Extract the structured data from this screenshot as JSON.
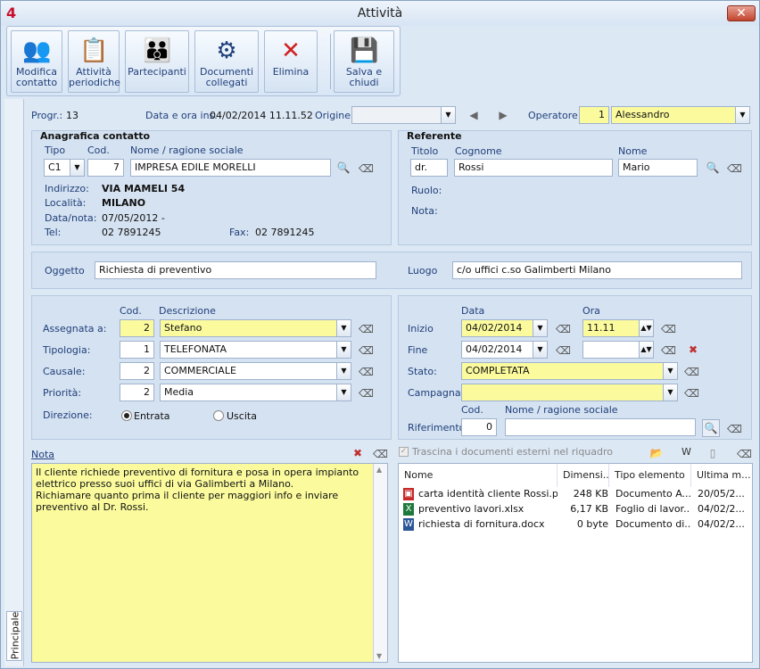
{
  "window": {
    "app_number": "4",
    "title": "Attività",
    "close": "✕"
  },
  "toolbar": {
    "modifica": "Modifica contatto",
    "attivita": "Attività periodiche",
    "partecipanti": "Partecipanti",
    "documenti": "Documenti collegati",
    "elimina": "Elimina",
    "salva": "Salva e chiudi"
  },
  "tab": {
    "principale": "Principale"
  },
  "header": {
    "progr_label": "Progr.:",
    "progr_value": "13",
    "data_label": "Data e ora ins.",
    "data_value": "04/02/2014 11.11.52",
    "origine_label": "Origine:",
    "origine_value": "",
    "operatore_label": "Operatore",
    "operatore_code": "1",
    "operatore_name": "Alessandro"
  },
  "anagrafica": {
    "title": "Anagrafica contatto",
    "tipo_label": "Tipo",
    "cod_label": "Cod.",
    "nome_label": "Nome / ragione sociale",
    "tipo": "C1",
    "cod": "7",
    "nome": "IMPRESA EDILE MORELLI",
    "indirizzo_label": "Indirizzo:",
    "indirizzo": "VIA MAMELI 54",
    "localita_label": "Località:",
    "localita": "MILANO",
    "datanota_label": "Data/nota:",
    "datanota": "07/05/2012 -",
    "tel_label": "Tel:",
    "tel": "02 7891245",
    "fax_label": "Fax:",
    "fax": "02 7891245"
  },
  "referente": {
    "title": "Referente",
    "titolo_label": "Titolo",
    "cognome_label": "Cognome",
    "nome_label": "Nome",
    "titolo": "dr.",
    "cognome": "Rossi",
    "nome": "Mario",
    "ruolo_label": "Ruolo:",
    "nota_label": "Nota:"
  },
  "oggetto": {
    "label": "Oggetto",
    "value": "Richiesta di preventivo",
    "luogo_label": "Luogo",
    "luogo": "c/o uffici c.so Galimberti Milano"
  },
  "assegnazione": {
    "cod_header": "Cod.",
    "desc_header": "Descrizione",
    "assegnata_label": "Assegnata a:",
    "assegnata_code": "2",
    "assegnata": "Stefano",
    "tipologia_label": "Tipologia:",
    "tipologia_code": "1",
    "tipologia": "TELEFONATA",
    "causale_label": "Causale:",
    "causale_code": "2",
    "causale": "COMMERCIALE",
    "priorita_label": "Priorità:",
    "priorita_code": "2",
    "priorita": "Media",
    "direzione_label": "Direzione:",
    "entrata": "Entrata",
    "uscita": "Uscita"
  },
  "tempi": {
    "data_header": "Data",
    "ora_header": "Ora",
    "inizio_label": "Inizio",
    "inizio_data": "04/02/2014",
    "inizio_ora": "11.11",
    "fine_label": "Fine",
    "fine_data": "04/02/2014",
    "fine_ora": "",
    "stato_label": "Stato:",
    "stato": "COMPLETATA",
    "campagna_label": "Campagna",
    "campagna": "",
    "cod_header": "Cod.",
    "nome_header": "Nome / ragione sociale",
    "riferimento_label": "Riferimento",
    "riferimento_code": "0",
    "riferimento_nome": ""
  },
  "nota": {
    "label": "Nota",
    "text": "Il cliente richiede preventivo di fornitura e posa in opera impianto elettrico presso suoi uffici di via Galimberti a Milano.\nRichiamare quanto prima il cliente per maggiori info e inviare preventivo al Dr. Rossi."
  },
  "documenti": {
    "trascina": "Trascina i documenti esterni nel riquadro",
    "w": "W",
    "columns": [
      "Nome",
      "Dimensi...",
      "Tipo elemento",
      "Ultima m..."
    ],
    "rows": [
      {
        "icon": "pdf-icon",
        "name": "carta identità cliente Rossi.pdf",
        "size": "248 KB",
        "type": "Documento A...",
        "date": "20/05/2..."
      },
      {
        "icon": "excel-icon",
        "name": "preventivo lavori.xlsx",
        "size": "6,17 KB",
        "type": "Foglio di lavor...",
        "date": "04/02/2..."
      },
      {
        "icon": "word-icon",
        "name": "richiesta di fornitura.docx",
        "size": "0 byte",
        "type": "Documento di...",
        "date": "04/02/2..."
      }
    ]
  },
  "colors": {
    "accent": "#1f3f7a",
    "required": "#fbfb9e",
    "panel": "#d5e2f1"
  }
}
